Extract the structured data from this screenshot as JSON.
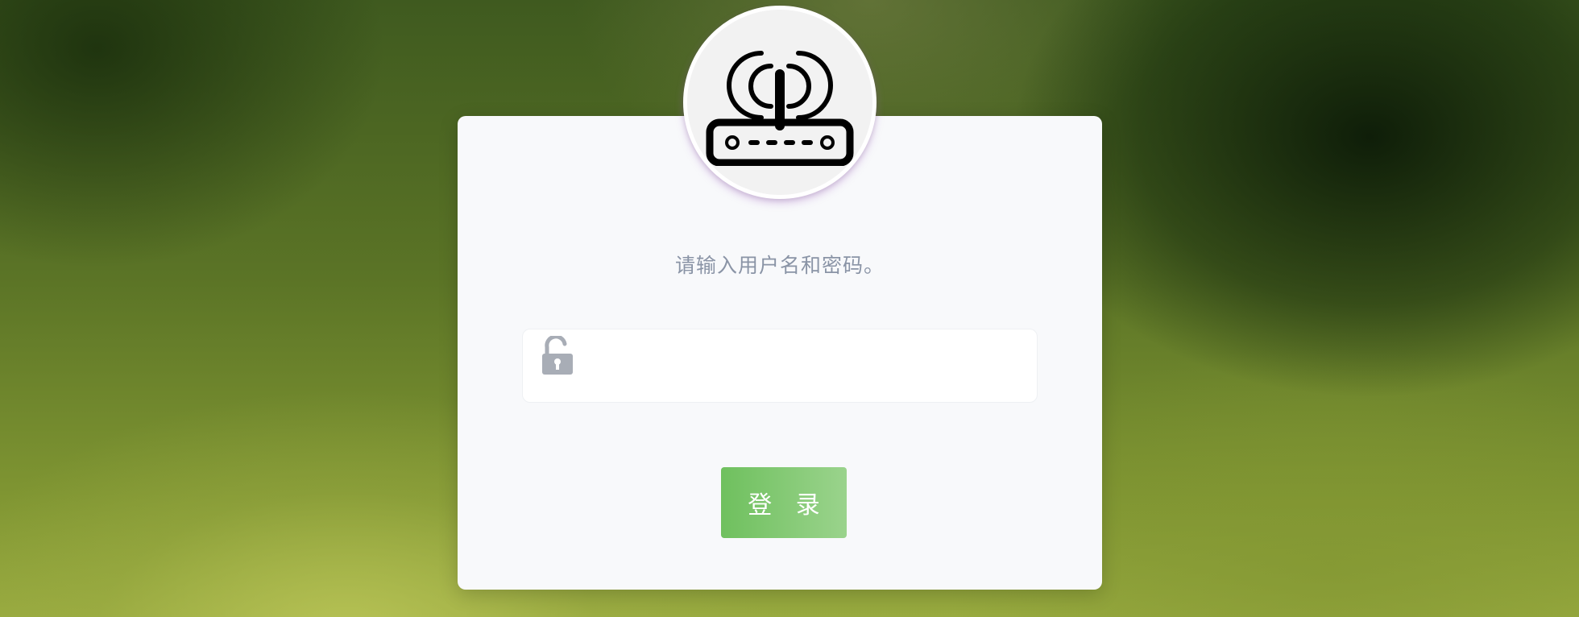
{
  "login": {
    "prompt": "请输入用户名和密码。",
    "password_value": "",
    "password_placeholder": "",
    "login_label": "登 录"
  },
  "icons": {
    "logo": "wireless-router-icon",
    "password": "unlocked-padlock-icon"
  },
  "colors": {
    "card_background": "#f8f9fb",
    "prompt_text": "#8a94a6",
    "button_gradient_start": "#6fc05e",
    "button_gradient_end": "#9ad38c",
    "icon_gray": "#a8adb6"
  }
}
